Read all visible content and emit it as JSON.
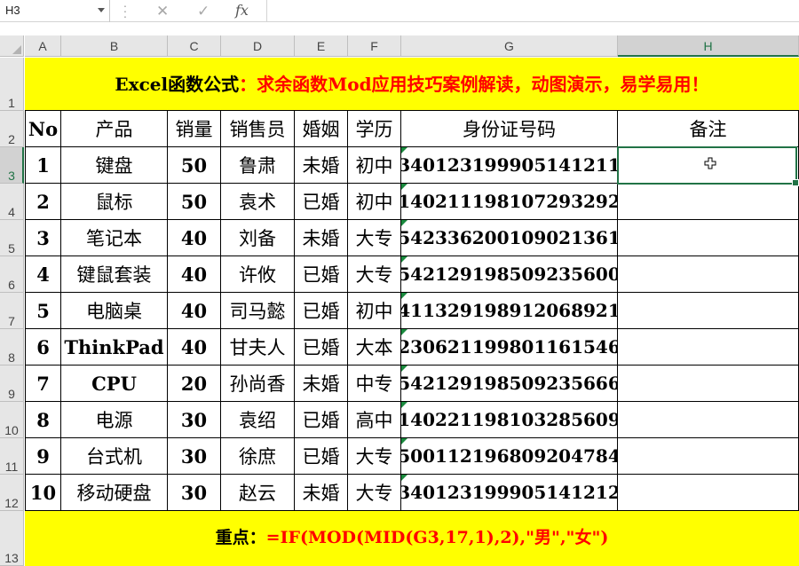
{
  "formula_bar": {
    "name_box": "H3",
    "cancel_icon": "✕",
    "enter_icon": "✓",
    "fx_label": "fx",
    "content": ""
  },
  "columns": [
    "A",
    "B",
    "C",
    "D",
    "E",
    "F",
    "G",
    "H"
  ],
  "selected_column": "H",
  "rows": [
    "1",
    "2",
    "3",
    "4",
    "5",
    "6",
    "7",
    "8",
    "9",
    "10",
    "11",
    "12",
    "13"
  ],
  "selected_row": "3",
  "title": {
    "black": "Excel函数公式",
    "red": "：求余函数Mod应用技巧案例解读，动图演示，易学易用！"
  },
  "table": {
    "headers": [
      "No",
      "产品",
      "销量",
      "销售员",
      "婚姻",
      "学历",
      "身份证号码",
      "备注"
    ],
    "rows": [
      [
        "1",
        "键盘",
        "50",
        "鲁肃",
        "未婚",
        "初中",
        "340123199905141211",
        ""
      ],
      [
        "2",
        "鼠标",
        "50",
        "袁术",
        "已婚",
        "初中",
        "140211198107293292",
        ""
      ],
      [
        "3",
        "笔记本",
        "40",
        "刘备",
        "未婚",
        "大专",
        "542336200109021361",
        ""
      ],
      [
        "4",
        "键鼠套装",
        "40",
        "许攸",
        "已婚",
        "大专",
        "542129198509235600",
        ""
      ],
      [
        "5",
        "电脑桌",
        "40",
        "司马懿",
        "已婚",
        "初中",
        "411329198912068921",
        ""
      ],
      [
        "6",
        "ThinkPad",
        "40",
        "甘夫人",
        "已婚",
        "大本",
        "230621199801161546",
        ""
      ],
      [
        "7",
        "CPU",
        "20",
        "孙尚香",
        "未婚",
        "中专",
        "542129198509235666",
        ""
      ],
      [
        "8",
        "电源",
        "30",
        "袁绍",
        "已婚",
        "高中",
        "140221198103285609",
        ""
      ],
      [
        "9",
        "台式机",
        "30",
        "徐庶",
        "已婚",
        "大专",
        "500112196809204784",
        ""
      ],
      [
        "10",
        "移动硬盘",
        "30",
        "赵云",
        "未婚",
        "大专",
        "340123199905141212",
        ""
      ]
    ]
  },
  "footer": {
    "label": "重点：",
    "formula": "=IF(MOD(MID(G3,17,1),2),\"男\",\"女\")"
  },
  "colors": {
    "band": "#ffff00",
    "red_text": "#ff0000",
    "selection": "#217346"
  }
}
